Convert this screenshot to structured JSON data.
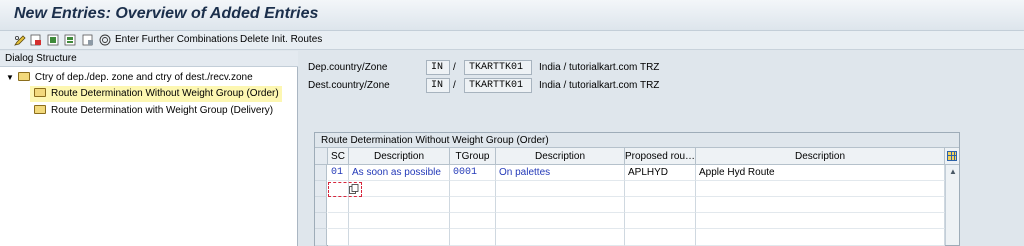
{
  "title": "New Entries: Overview of Added Entries",
  "toolbar": {
    "icons": [
      "pencil-glasses-icon",
      "delete-icon",
      "select-all-icon",
      "select-block-icon",
      "deselect-icon",
      "combinations-icon"
    ],
    "enter_combinations": "Enter Further Combinations",
    "delete_routes": "Delete Init. Routes"
  },
  "dialog": {
    "header": "Dialog Structure",
    "root": "Ctry of dep./dep. zone and ctry of dest./recv.zone",
    "items": [
      {
        "label": "Route Determination Without Weight Group (Order)",
        "selected": true
      },
      {
        "label": "Route Determination with Weight Group (Delivery)",
        "selected": false
      }
    ]
  },
  "fields": {
    "dep_label": "Dep.country/Zone",
    "dep_country": "IN",
    "dep_zone": "TKARTTK01",
    "dep_desc": "India / tutorialkart.com TRZ",
    "dest_label": "Dest.country/Zone",
    "dest_country": "IN",
    "dest_zone": "TKARTTK01",
    "dest_desc": "India / tutorialkart.com TRZ",
    "slash": "/"
  },
  "table": {
    "caption": "Route Determination Without Weight Group (Order)",
    "columns": [
      "SC",
      "Description",
      "TGroup",
      "Description",
      "Proposed rou…",
      "Description"
    ],
    "rows": [
      {
        "sc": "01",
        "sc_desc": "As soon as possible",
        "tgroup": "0001",
        "tg_desc": "On palettes",
        "route": "APLHYD",
        "route_desc": "Apple Hyd Route"
      }
    ]
  },
  "colors": {
    "link_blue": "#2339b8",
    "selected_row": "#fdf7b2",
    "title_color": "#1b2f4b"
  }
}
